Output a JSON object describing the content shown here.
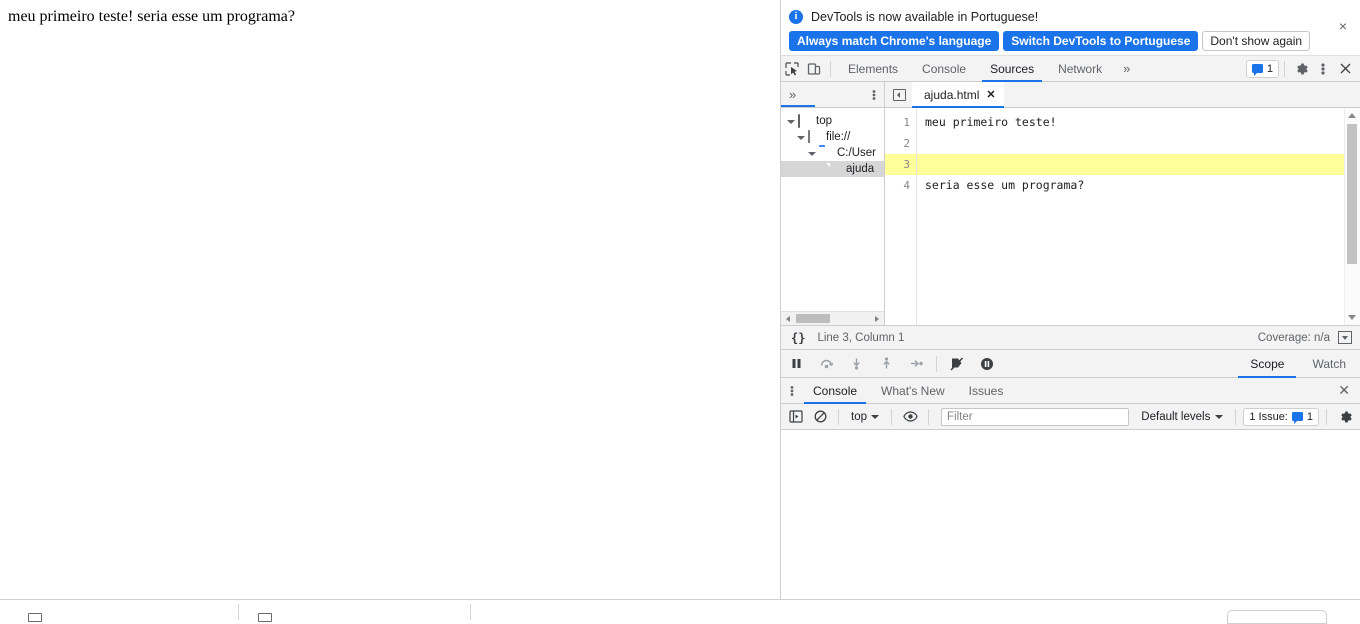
{
  "page": {
    "content_text": "meu primeiro teste! seria esse um programa?"
  },
  "notification": {
    "icon": "info-icon",
    "message": "DevTools is now available in Portuguese!",
    "primary_button": "Always match Chrome's language",
    "secondary_button": "Switch DevTools to Portuguese",
    "dismiss_button": "Don't show again",
    "close_icon": "×",
    "accent_color": "#1a73e8"
  },
  "main_toolbar": {
    "inspect_icon": "inspect-element-icon",
    "device_icon": "device-toolbar-icon",
    "tabs": [
      {
        "label": "Elements",
        "active": false
      },
      {
        "label": "Console",
        "active": false
      },
      {
        "label": "Sources",
        "active": true
      },
      {
        "label": "Network",
        "active": false
      }
    ],
    "overflow": "»",
    "issues_count": "1",
    "settings_icon": "gear-icon",
    "more_icon": "kebab-menu-icon",
    "close_icon": "✕"
  },
  "navigator": {
    "overflow": "»",
    "more_icon": "kebab-menu-icon",
    "tree": [
      {
        "label": "top",
        "icon": "frame-icon",
        "depth": 0,
        "expanded": true,
        "selected": false
      },
      {
        "label": "file://",
        "icon": "cloud-icon",
        "depth": 1,
        "expanded": true,
        "selected": false
      },
      {
        "label": "C:/User",
        "icon": "folder-icon",
        "depth": 2,
        "expanded": true,
        "selected": false
      },
      {
        "label": "ajuda",
        "icon": "file-icon",
        "depth": 3,
        "expanded": false,
        "selected": true
      }
    ]
  },
  "editor": {
    "collapse_icon": "collapse-sidebar-icon",
    "tab_name": "ajuda.html",
    "tab_close": "✕",
    "lines": [
      {
        "number": "1",
        "text": "meu primeiro teste!",
        "highlighted": false
      },
      {
        "number": "2",
        "text": "",
        "highlighted": false
      },
      {
        "number": "3",
        "text": "",
        "highlighted": true
      },
      {
        "number": "4",
        "text": "seria esse um programa?",
        "highlighted": false
      }
    ],
    "highlight_color": "#ffff99"
  },
  "status_bar": {
    "pretty_print_icon": "{}",
    "cursor_position": "Line 3, Column 1",
    "coverage": "Coverage: n/a",
    "coverage_dropdown_icon": "triangle-down-icon"
  },
  "debugger": {
    "buttons": [
      {
        "name": "pause-script-button"
      },
      {
        "name": "step-over-button"
      },
      {
        "name": "step-into-button"
      },
      {
        "name": "step-out-button"
      },
      {
        "name": "step-button"
      },
      {
        "name": "deactivate-breakpoints-button"
      },
      {
        "name": "pause-on-exceptions-button"
      }
    ],
    "tabs": [
      {
        "label": "Scope",
        "active": true
      },
      {
        "label": "Watch",
        "active": false
      }
    ]
  },
  "drawer": {
    "more_icon": "kebab-menu-icon",
    "tabs": [
      {
        "label": "Console",
        "active": true
      },
      {
        "label": "What's New",
        "active": false
      },
      {
        "label": "Issues",
        "active": false
      }
    ],
    "close_icon": "✕"
  },
  "console_toolbar": {
    "sidebar_icon": "console-sidebar-icon",
    "clear_icon": "clear-console-icon",
    "context": "top",
    "eye_icon": "live-expression-icon",
    "filter_placeholder": "Filter",
    "filter_value": "",
    "levels": "Default levels",
    "issues_label": "1 Issue:",
    "issues_count": "1",
    "settings_icon": "gear-icon"
  },
  "console": {
    "prompt": ">"
  }
}
